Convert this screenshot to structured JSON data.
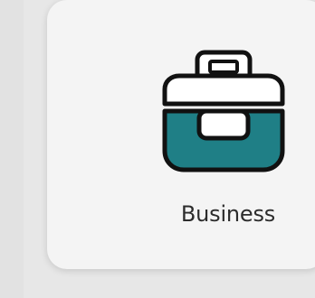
{
  "card": {
    "label": "Business",
    "icon": "briefcase-icon"
  },
  "colors": {
    "background": "#e7e7e7",
    "card": "#f4f4f4",
    "icon_teal": "#1f7f86",
    "icon_outline": "#111111",
    "label_text": "#2c2c2c"
  }
}
